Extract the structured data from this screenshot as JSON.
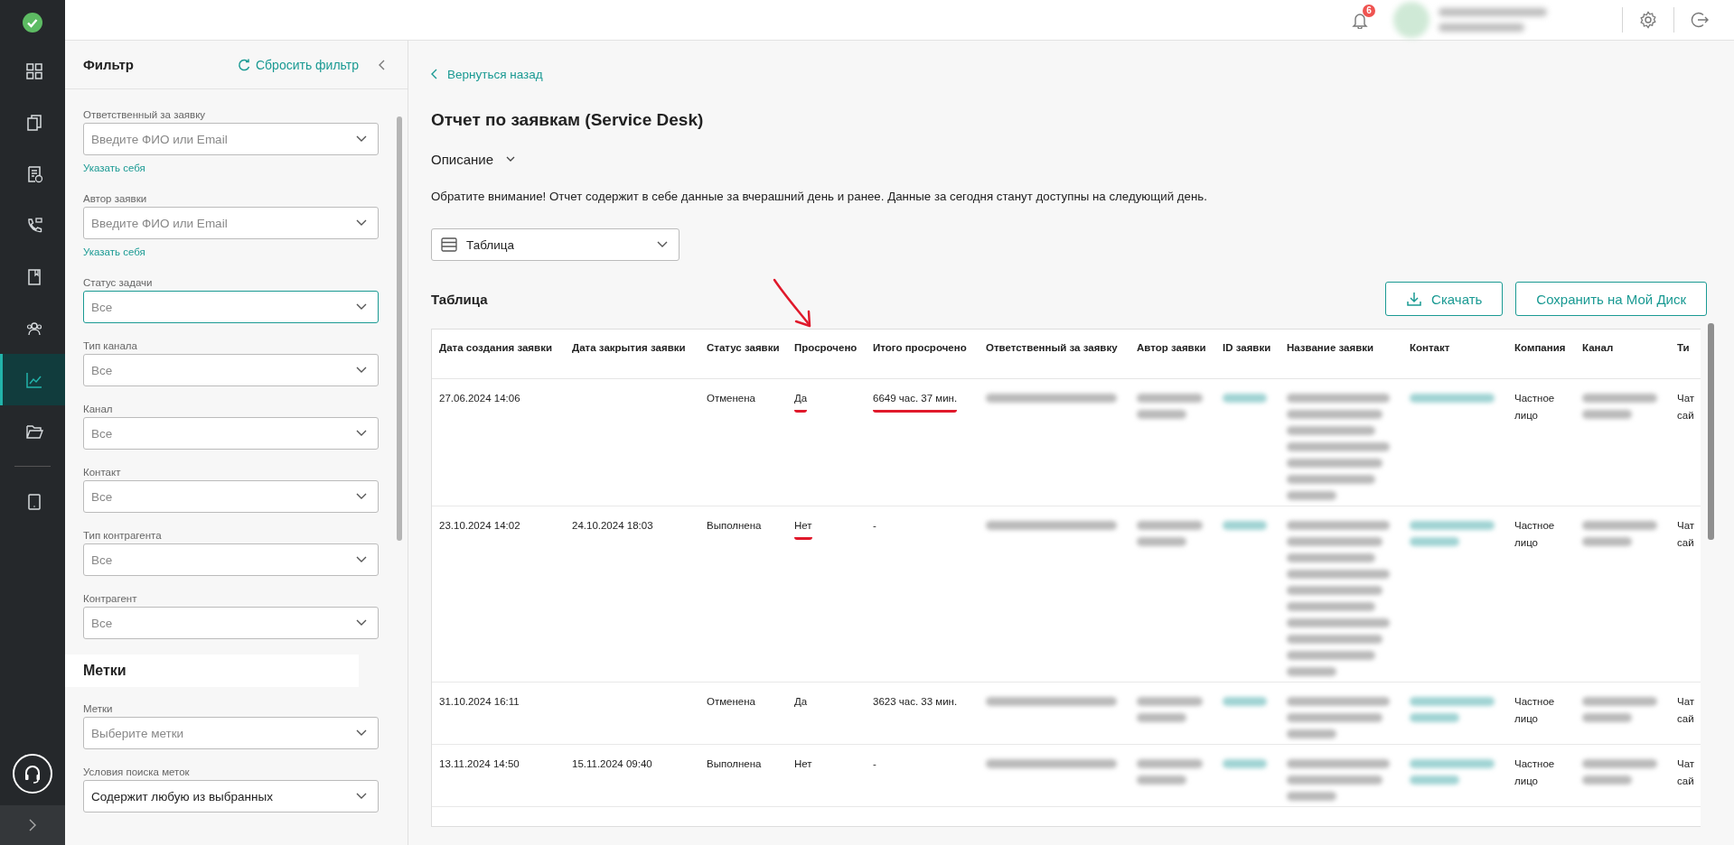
{
  "top_bar": {
    "notification_count": "6"
  },
  "rail": {
    "items": [
      {
        "kind": "dashboard",
        "selected": false
      },
      {
        "kind": "documents",
        "selected": false
      },
      {
        "kind": "requests",
        "selected": false
      },
      {
        "kind": "calls",
        "selected": false
      },
      {
        "kind": "book",
        "selected": false
      },
      {
        "kind": "users",
        "selected": false
      },
      {
        "kind": "chart",
        "selected": true
      },
      {
        "kind": "folder",
        "selected": false
      },
      {
        "kind": "tablet",
        "selected": false
      }
    ]
  },
  "filter": {
    "title": "Фильтр",
    "reset": "Сбросить фильтр",
    "fields": [
      {
        "label": "Ответственный за заявку",
        "placeholder": "Введите ФИО или Email",
        "link": "Указать себя",
        "focused": false
      },
      {
        "label": "Автор заявки",
        "placeholder": "Введите ФИО или Email",
        "link": "Указать себя",
        "focused": false
      },
      {
        "label": "Статус задачи",
        "placeholder": "Все",
        "focused": true
      },
      {
        "label": "Тип канала",
        "placeholder": "Все",
        "focused": false
      },
      {
        "label": "Канал",
        "placeholder": "Все",
        "focused": false
      },
      {
        "label": "Контакт",
        "placeholder": "Все",
        "focused": false
      },
      {
        "label": "Тип контрагента",
        "placeholder": "Все",
        "focused": false
      },
      {
        "label": "Контрагент",
        "placeholder": "Все",
        "focused": false
      }
    ],
    "tags_title": "Метки",
    "tag_fields": [
      {
        "label": "Метки",
        "placeholder": "Выберите метки",
        "focused": false
      },
      {
        "label": "Условия поиска меток",
        "value": "Содержит любую из выбранных",
        "focused": false
      }
    ]
  },
  "report": {
    "back": "Вернуться назад",
    "title": "Отчет по заявкам (Service Desk)",
    "description_toggle": "Описание",
    "notice": "Обратите внимание! Отчет содержит в себе данные за вчерашний день и ранее. Данные за сегодня станут доступны на следующий день.",
    "view_select": "Таблица",
    "section_title": "Таблица",
    "buttons": [
      {
        "kind": "download",
        "label": "Скачать"
      },
      {
        "kind": "save",
        "label": "Сохранить на Мой Диск"
      }
    ]
  },
  "table": {
    "columns": [
      {
        "label": "Дата создания заявки"
      },
      {
        "label": "Дата закрытия заявки"
      },
      {
        "label": "Статус заявки"
      },
      {
        "label": "Просрочено"
      },
      {
        "label": "Итого просрочено"
      },
      {
        "label": "Ответственный за заявку"
      },
      {
        "label": "Автор заявки"
      },
      {
        "label": "ID заявки"
      },
      {
        "label": "Название заявки"
      },
      {
        "label": "Контакт"
      },
      {
        "label": "Компания"
      },
      {
        "label": "Канал"
      },
      {
        "label": "Ти"
      }
    ],
    "annotations": [
      {
        "kind": "arrow"
      }
    ],
    "rows": [
      {
        "cells": [
          {
            "kind": "text",
            "text": "27.06.2024 14:06",
            "marked": false
          },
          {
            "kind": "empty"
          },
          {
            "kind": "text",
            "text": "Отменена",
            "marked": false
          },
          {
            "kind": "text",
            "text": "Да",
            "marked": true
          },
          {
            "kind": "text",
            "text": "6649 час. 37 мин.",
            "marked": true
          },
          {
            "kind": "redacted"
          },
          {
            "kind": "redacted"
          },
          {
            "kind": "redacted-link"
          },
          {
            "kind": "redacted"
          },
          {
            "kind": "redacted-link"
          },
          {
            "kind": "text",
            "text": "Частное лицо",
            "marked": false
          },
          {
            "kind": "redacted"
          },
          {
            "kind": "text",
            "text": "Чат сай",
            "marked": false
          }
        ]
      },
      {
        "cells": [
          {
            "kind": "text",
            "text": "23.10.2024 14:02",
            "marked": false
          },
          {
            "kind": "text",
            "text": "24.10.2024 18:03",
            "marked": false
          },
          {
            "kind": "text",
            "text": "Выполнена",
            "marked": false
          },
          {
            "kind": "text",
            "text": "Нет",
            "marked": true
          },
          {
            "kind": "text",
            "text": "-",
            "marked": false
          },
          {
            "kind": "redacted"
          },
          {
            "kind": "redacted"
          },
          {
            "kind": "redacted-link"
          },
          {
            "kind": "redacted"
          },
          {
            "kind": "redacted-link"
          },
          {
            "kind": "text",
            "text": "Частное лицо",
            "marked": false
          },
          {
            "kind": "redacted"
          },
          {
            "kind": "text",
            "text": "Чат сай",
            "marked": false
          }
        ]
      },
      {
        "cells": [
          {
            "kind": "text",
            "text": "31.10.2024 16:11",
            "marked": false
          },
          {
            "kind": "empty"
          },
          {
            "kind": "text",
            "text": "Отменена",
            "marked": false
          },
          {
            "kind": "text",
            "text": "Да",
            "marked": false
          },
          {
            "kind": "text",
            "text": "3623 час. 33 мин.",
            "marked": false
          },
          {
            "kind": "redacted"
          },
          {
            "kind": "redacted"
          },
          {
            "kind": "redacted-link"
          },
          {
            "kind": "redacted"
          },
          {
            "kind": "redacted-link"
          },
          {
            "kind": "text",
            "text": "Частное лицо",
            "marked": false
          },
          {
            "kind": "redacted"
          },
          {
            "kind": "text",
            "text": "Чат сай",
            "marked": false
          }
        ]
      },
      {
        "cells": [
          {
            "kind": "text",
            "text": "13.11.2024 14:50",
            "marked": false
          },
          {
            "kind": "text",
            "text": "15.11.2024 09:40",
            "marked": false
          },
          {
            "kind": "text",
            "text": "Выполнена",
            "marked": false
          },
          {
            "kind": "text",
            "text": "Нет",
            "marked": false
          },
          {
            "kind": "text",
            "text": "-",
            "marked": false
          },
          {
            "kind": "redacted"
          },
          {
            "kind": "redacted"
          },
          {
            "kind": "redacted-link"
          },
          {
            "kind": "redacted"
          },
          {
            "kind": "redacted-link"
          },
          {
            "kind": "text",
            "text": "Частное лицо",
            "marked": false
          },
          {
            "kind": "redacted"
          },
          {
            "kind": "text",
            "text": "Чат сай",
            "marked": false
          }
        ]
      }
    ]
  }
}
